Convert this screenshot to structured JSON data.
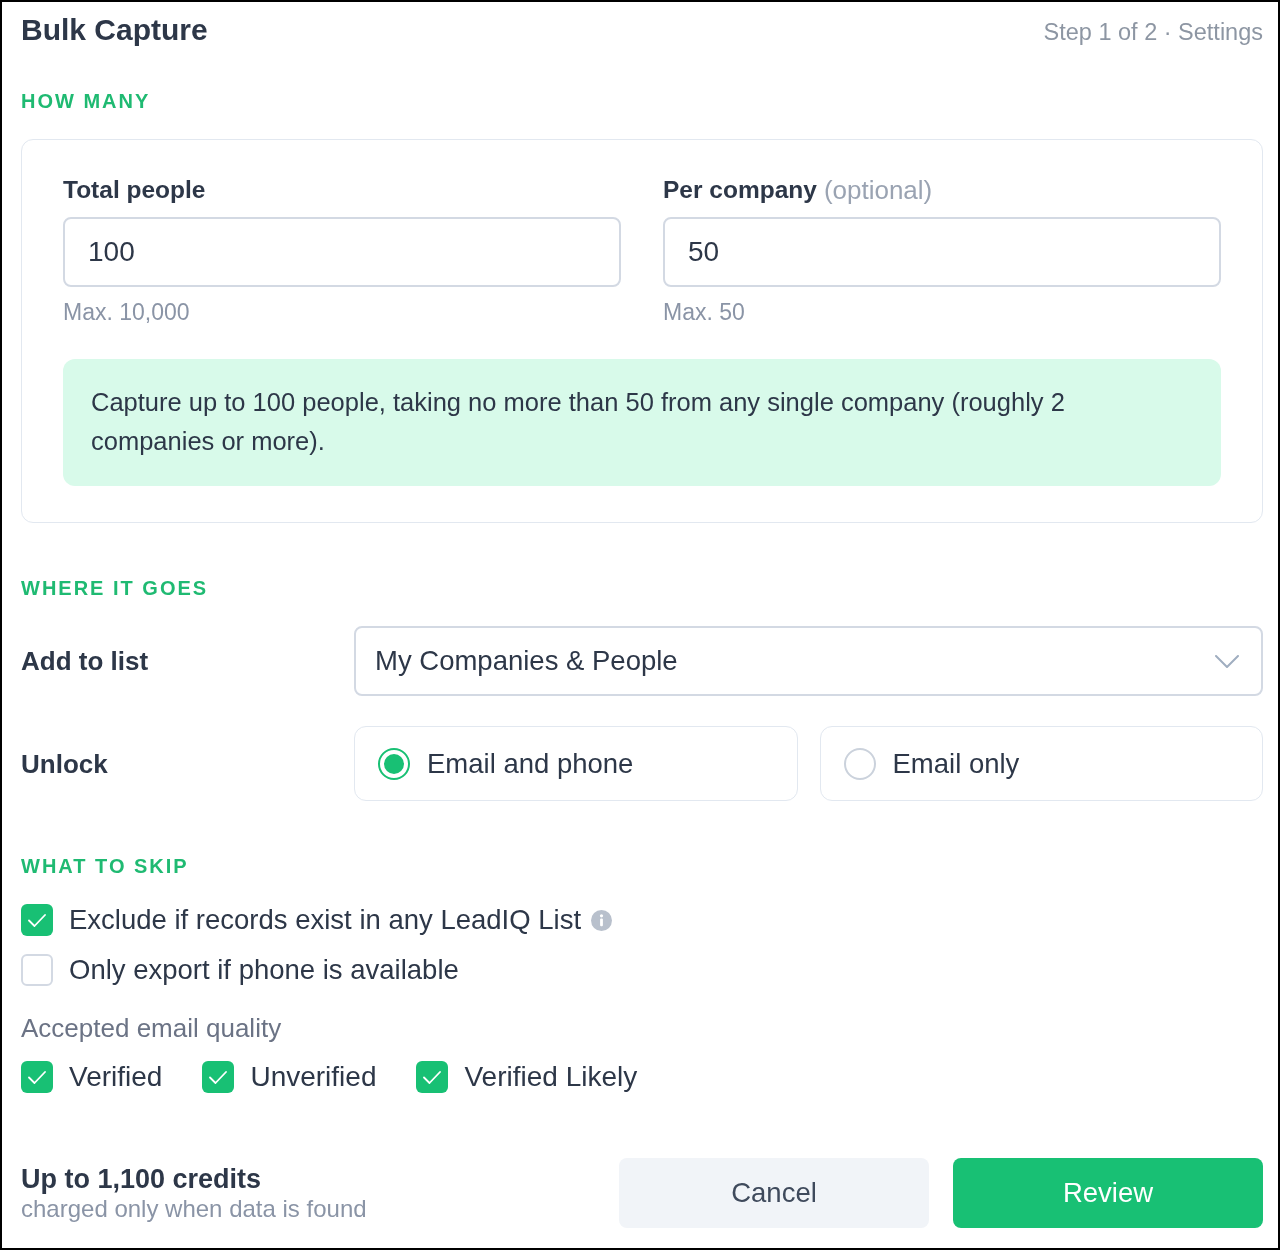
{
  "header": {
    "title": "Bulk Capture",
    "step": "Step 1 of 2 · Settings"
  },
  "how_many": {
    "heading": "HOW MANY",
    "fields": [
      {
        "label": "Total people",
        "value": "100",
        "hint": "Max. 10,000"
      },
      {
        "label": "Per company",
        "label_note": "(optional)",
        "value": "50",
        "hint": "Max. 50"
      }
    ],
    "summary": "Capture up to 100 people, taking no more than 50 from any single company (roughly 2 companies or more)."
  },
  "where_it_goes": {
    "heading": "WHERE IT GOES",
    "list": {
      "label": "Add to list",
      "value": "My Companies & People"
    },
    "unlock": {
      "label": "Unlock",
      "options": [
        {
          "label": "Email and phone",
          "selected": true
        },
        {
          "label": "Email only",
          "selected": false
        }
      ]
    }
  },
  "what_to_skip": {
    "heading": "WHAT TO SKIP",
    "options": [
      {
        "label": "Exclude if records exist in any LeadIQ List",
        "checked": true,
        "info": true
      },
      {
        "label": "Only export if phone is available",
        "checked": false
      }
    ],
    "quality": {
      "label": "Accepted email quality",
      "options": [
        {
          "label": "Verified",
          "checked": true
        },
        {
          "label": "Unverified",
          "checked": true
        },
        {
          "label": "Verified Likely",
          "checked": true
        }
      ]
    }
  },
  "footer": {
    "credits": "Up to 1,100 credits",
    "note": "charged only when data is found",
    "buttons": [
      {
        "label": "Cancel",
        "kind": "secondary"
      },
      {
        "label": "Review",
        "kind": "primary"
      }
    ]
  }
}
